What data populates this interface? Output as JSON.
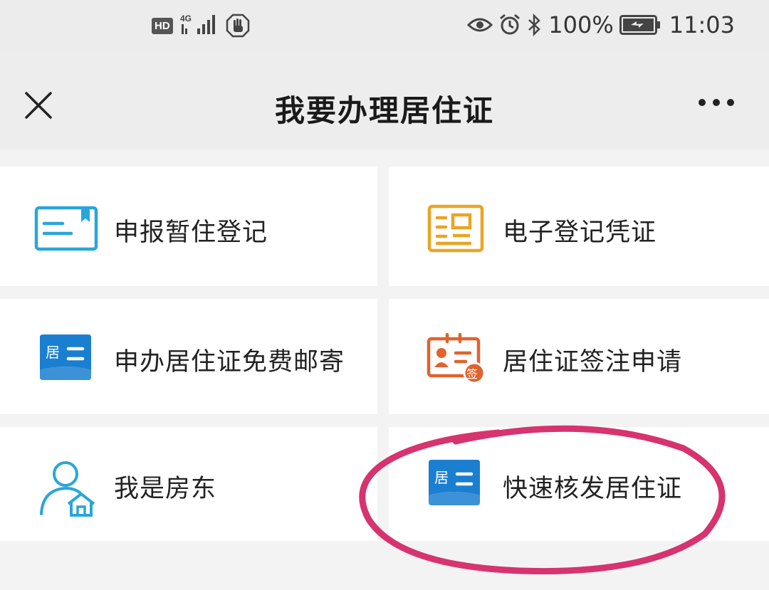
{
  "status_bar": {
    "hd": "HD",
    "network": "4G",
    "battery_percent": "100%",
    "time": "11:03"
  },
  "nav": {
    "title": "我要办理居住证"
  },
  "menu": {
    "items": [
      {
        "label": "申报暂住登记",
        "icon": "id-card-flag-icon",
        "color": "#2aa6d9"
      },
      {
        "label": "电子登记凭证",
        "icon": "document-icon",
        "color": "#e9a521"
      },
      {
        "label": "申办居住证免费邮寄",
        "icon": "residence-card-icon",
        "color": "#1a7fd0"
      },
      {
        "label": "居住证签注申请",
        "icon": "badge-sign-icon",
        "color": "#e0632c"
      },
      {
        "label": "我是房东",
        "icon": "landlord-icon",
        "color": "#2aa6d9"
      },
      {
        "label": "快速核发居住证",
        "icon": "residence-card-icon",
        "color": "#1a7fd0"
      }
    ]
  },
  "card_icon_text": {
    "ju": "居",
    "qian": "签"
  },
  "highlight_color": "#d6336f"
}
